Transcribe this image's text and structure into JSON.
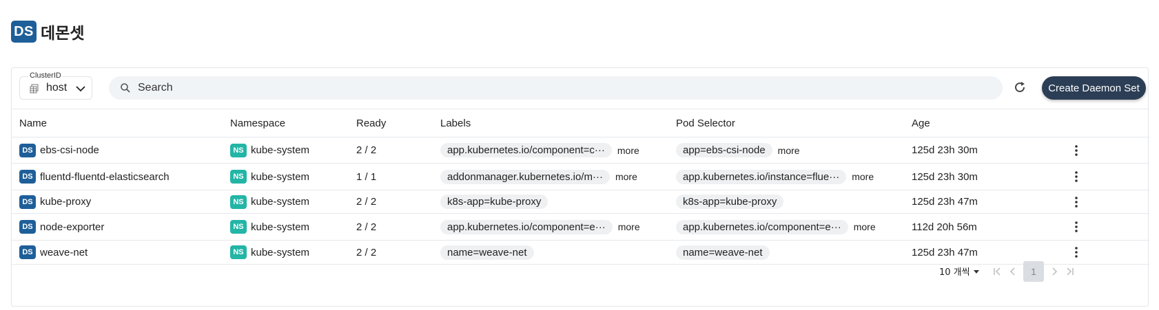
{
  "header": {
    "badge": "DS",
    "title": "데몬셋"
  },
  "toolbar": {
    "cluster_label": "ClusterID",
    "cluster_value": "host",
    "search_placeholder": "Search",
    "create_label": "Create Daemon Set"
  },
  "table": {
    "columns": [
      "Name",
      "Namespace",
      "Ready",
      "Labels",
      "Pod Selector",
      "Age"
    ],
    "rows": [
      {
        "name": "ebs-csi-node",
        "namespace": "kube-system",
        "ready": "2 / 2",
        "label": "app.kubernetes.io/component=c···",
        "label_more": "more",
        "selector": "app=ebs-csi-node",
        "selector_more": "more",
        "age": "125d 23h 30m"
      },
      {
        "name": "fluentd-fluentd-elasticsearch",
        "namespace": "kube-system",
        "ready": "1 / 1",
        "label": "addonmanager.kubernetes.io/m···",
        "label_more": "more",
        "selector": "app.kubernetes.io/instance=flue···",
        "selector_more": "more",
        "age": "125d 23h 30m"
      },
      {
        "name": "kube-proxy",
        "namespace": "kube-system",
        "ready": "2 / 2",
        "label": "k8s-app=kube-proxy",
        "label_more": "",
        "selector": "k8s-app=kube-proxy",
        "selector_more": "",
        "age": "125d 23h 47m"
      },
      {
        "name": "node-exporter",
        "namespace": "kube-system",
        "ready": "2 / 2",
        "label": "app.kubernetes.io/component=e···",
        "label_more": "more",
        "selector": "app.kubernetes.io/component=e···",
        "selector_more": "more",
        "age": "112d 20h 56m"
      },
      {
        "name": "weave-net",
        "namespace": "kube-system",
        "ready": "2 / 2",
        "label": "name=weave-net",
        "label_more": "",
        "selector": "name=weave-net",
        "selector_more": "",
        "age": "125d 23h 47m"
      }
    ],
    "badge_ds": "DS",
    "badge_ns": "NS"
  },
  "footer": {
    "rows_per_page": "10 개씩",
    "current_page": "1"
  },
  "colors": {
    "ds_badge": "#1f5f99",
    "ns_badge": "#23b5a6",
    "create_button": "#2c3e55"
  },
  "icons": [
    "cluster-icon",
    "chevron-down-icon",
    "search-icon",
    "refresh-icon",
    "kebab-menu-icon",
    "first-page-icon",
    "prev-page-icon",
    "next-page-icon",
    "last-page-icon"
  ]
}
